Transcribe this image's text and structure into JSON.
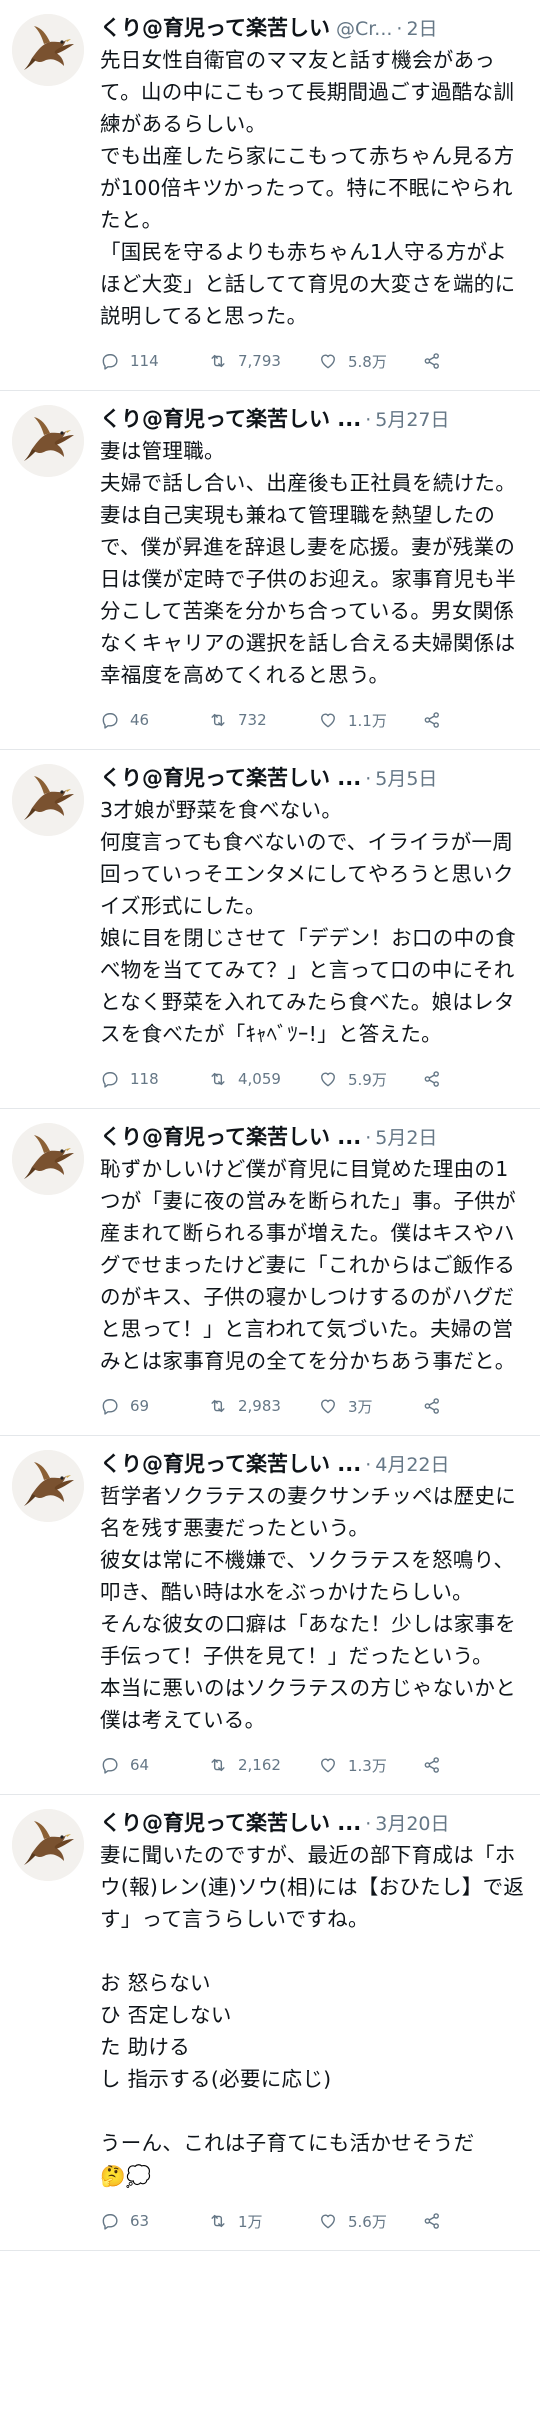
{
  "colors": {
    "text": "#0f1419",
    "muted": "#657786",
    "divider": "#e4e7ea"
  },
  "avatar_icon": "bird-avatar-icon",
  "tweets": [
    {
      "name": "くり@育児って楽苦しい",
      "handle": "@Cr...",
      "time": "2日",
      "text": "先日女性自衛官のママ友と話す機会があって。山の中にこもって長期間過ごす過酷な訓練があるらしい。\nでも出産したら家にこもって赤ちゃん見る方が100倍キツかったって。特に不眠にやられたと。\n「国民を守るよりも赤ちゃん1人守る方がよほど大変」と話してて育児の大変さを端的に説明してると思った。",
      "replies": "114",
      "retweets": "7,793",
      "likes": "5.8万"
    },
    {
      "name": "くり@育児って楽苦しい ...",
      "handle": "",
      "time": "5月27日",
      "text": "妻は管理職。\n夫婦で話し合い、出産後も正社員を続けた。妻は自己実現も兼ねて管理職を熱望したので、僕が昇進を辞退し妻を応援。妻が残業の日は僕が定時で子供のお迎え。家事育児も半分こして苦楽を分かち合っている。男女関係なくキャリアの選択を話し合える夫婦関係は幸福度を高めてくれると思う。",
      "replies": "46",
      "retweets": "732",
      "likes": "1.1万"
    },
    {
      "name": "くり@育児って楽苦しい ...",
      "handle": "",
      "time": "5月5日",
      "text": "3才娘が野菜を食べない。\n何度言っても食べないので、イライラが一周回っていっそエンタメにしてやろうと思いクイズ形式にした。\n娘に目を閉じさせて「デデン！お口の中の食べ物を当ててみて？」と言って口の中にそれとなく野菜を入れてみたら食べた。娘はレタスを食べたが「ｷｬﾍﾞﾂｰ!」と答えた。",
      "replies": "118",
      "retweets": "4,059",
      "likes": "5.9万"
    },
    {
      "name": "くり@育児って楽苦しい ...",
      "handle": "",
      "time": "5月2日",
      "text": "恥ずかしいけど僕が育児に目覚めた理由の1つが「妻に夜の営みを断られた」事。子供が産まれて断られる事が増えた。僕はキスやハグでせまったけど妻に「これからはご飯作るのがキス、子供の寝かしつけするのがハグだと思って！」と言われて気づいた。夫婦の営みとは家事育児の全てを分かちあう事だと。",
      "replies": "69",
      "retweets": "2,983",
      "likes": "3万"
    },
    {
      "name": "くり@育児って楽苦しい ...",
      "handle": "",
      "time": "4月22日",
      "text": "哲学者ソクラテスの妻クサンチッペは歴史に名を残す悪妻だったという。\n彼女は常に不機嫌で、ソクラテスを怒鳴り、叩き、酷い時は水をぶっかけたらしい。\nそんな彼女の口癖は「あなた！少しは家事を手伝って！子供を見て！」だったという。\n本当に悪いのはソクラテスの方じゃないかと僕は考えている。",
      "replies": "64",
      "retweets": "2,162",
      "likes": "1.3万"
    },
    {
      "name": "くり@育児って楽苦しい ...",
      "handle": "",
      "time": "3月20日",
      "text": "妻に聞いたのですが、最近の部下育成は「ホウ(報)レン(連)ソウ(相)には【おひたし】で返す」って言うらしいですね。\n\nお 怒らない\nひ 否定しない\nた 助ける\nし 指示する(必要に応じ)\n\nうーん、これは子育てにも活かせそうだ",
      "emoji_after_text": "🤔💭",
      "replies": "63",
      "retweets": "1万",
      "likes": "5.6万"
    }
  ]
}
